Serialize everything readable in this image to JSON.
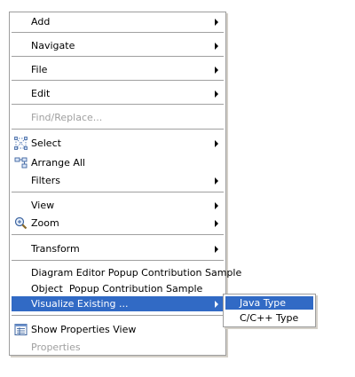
{
  "menu": {
    "items": {
      "add": "Add",
      "navigate": "Navigate",
      "file": "File",
      "edit": "Edit",
      "find_replace": "Find/Replace...",
      "select": "Select",
      "arrange_all": "Arrange All",
      "filters": "Filters",
      "view": "View",
      "zoom": "Zoom",
      "transform": "Transform",
      "diagram_editor_popup": "Diagram Editor Popup Contribution Sample",
      "object_popup": "Object  Popup Contribution Sample",
      "visualize_existing": "Visualize Existing ...",
      "show_properties_view": "Show Properties View",
      "properties": "Properties"
    },
    "icons": {
      "select": "select-icon",
      "arrange_all": "arrange-all-icon",
      "zoom": "zoom-icon",
      "show_properties_view": "properties-view-icon"
    }
  },
  "submenu": {
    "java_type": "Java Type",
    "c_cpp_type": "C/C++ Type"
  },
  "colors": {
    "highlight": "#316ac5",
    "disabled_text": "#a0a0a0",
    "border": "#9d9d9d"
  }
}
